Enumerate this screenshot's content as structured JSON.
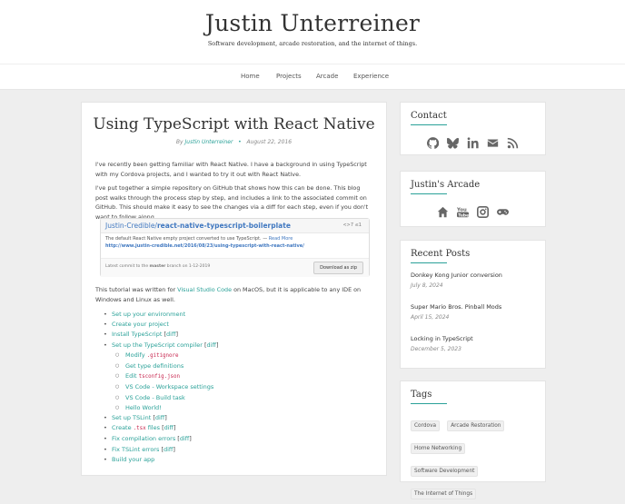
{
  "site": {
    "title": "Justin Unterreiner",
    "tagline": "Software development, arcade restoration, and the internet of things."
  },
  "nav": [
    "Home",
    "Projects",
    "Arcade",
    "Experience"
  ],
  "post": {
    "title": "Using TypeScript with React Native",
    "by": "By",
    "author": "Justin Unterreiner",
    "separator": "•",
    "date": "August 22, 2016",
    "p1": "I've recently been getting familiar with React Native. I have a background in using TypeScript with my Cordova projects, and I wanted to try it out with React Native.",
    "p2": "I've put together a simple repository on GitHub that shows how this can be done. This blog post walks through the process step by step, and includes a link to the associated commit on GitHub. This should make it easy to see the changes via a diff for each step, even if you don't want to follow along.",
    "repo": {
      "owner": "Justin-Credible/",
      "name": "react-native-typescript-boilerplate",
      "stat": "<>7 ≤1",
      "desc": "The default React Native empty project converted to use TypeScript. — ",
      "readmore": "Read More",
      "url": "http://www.justin-credible.net/2016/08/23/using-typescript-with-react-native/",
      "commit_prefix": "Latest commit to the ",
      "branch": "master",
      "commit_suffix": " branch on 1-12-2019",
      "download": "Download as zip"
    },
    "p3_pre": "This tutorial was written for ",
    "p3_link": "Visual Studio Code",
    "p3_post": " on MacOS, but it is applicable to any IDE on Windows and Linux as well.",
    "toc": {
      "i1": "Set up your environment",
      "i2": "Create your project",
      "i3": "Install TypeScript",
      "i4": "Set up the TypeScript compiler",
      "s1_pre": "Modify ",
      "s1_code": ".gitignore",
      "s2": "Get type definitions",
      "s3_pre": "Edit ",
      "s3_code": "tsconfig.json",
      "s4": "VS Code - Workspace settings",
      "s5": "VS Code - Build task",
      "s6": "Hello World!",
      "i5": "Set up TSLint",
      "i6_pre": "Create ",
      "i6_code": ".tsx",
      "i6_post": " files",
      "i7": "Fix compilation errors",
      "i8": "Fix TSLint errors",
      "i9": "Build your app",
      "diff": "diff",
      "lb": " [",
      "rb": "]"
    }
  },
  "sidebar": {
    "contact": {
      "title": "Contact",
      "icons": [
        "github-icon",
        "butterfly-icon",
        "linkedin-icon",
        "mail-icon",
        "rss-icon"
      ]
    },
    "arcade": {
      "title": "Justin's Arcade",
      "icons": [
        "home-icon",
        "youtube-icon",
        "instagram-icon",
        "gamepad-icon"
      ]
    },
    "recent": {
      "title": "Recent Posts",
      "posts": [
        {
          "title": "Donkey Kong Junior conversion",
          "date": "July 8, 2024"
        },
        {
          "title": "Super Mario Bros. Pinball Mods",
          "date": "April 15, 2024"
        },
        {
          "title": "Locking in TypeScript",
          "date": "December 5, 2023"
        }
      ]
    },
    "tags": {
      "title": "Tags",
      "items": [
        "Cordova",
        "Arcade Restoration",
        "Home Networking",
        "Software Development",
        "The Internet of Things"
      ]
    }
  },
  "colors": {
    "accent": "#2aa198",
    "link_blue": "#4078c0"
  }
}
